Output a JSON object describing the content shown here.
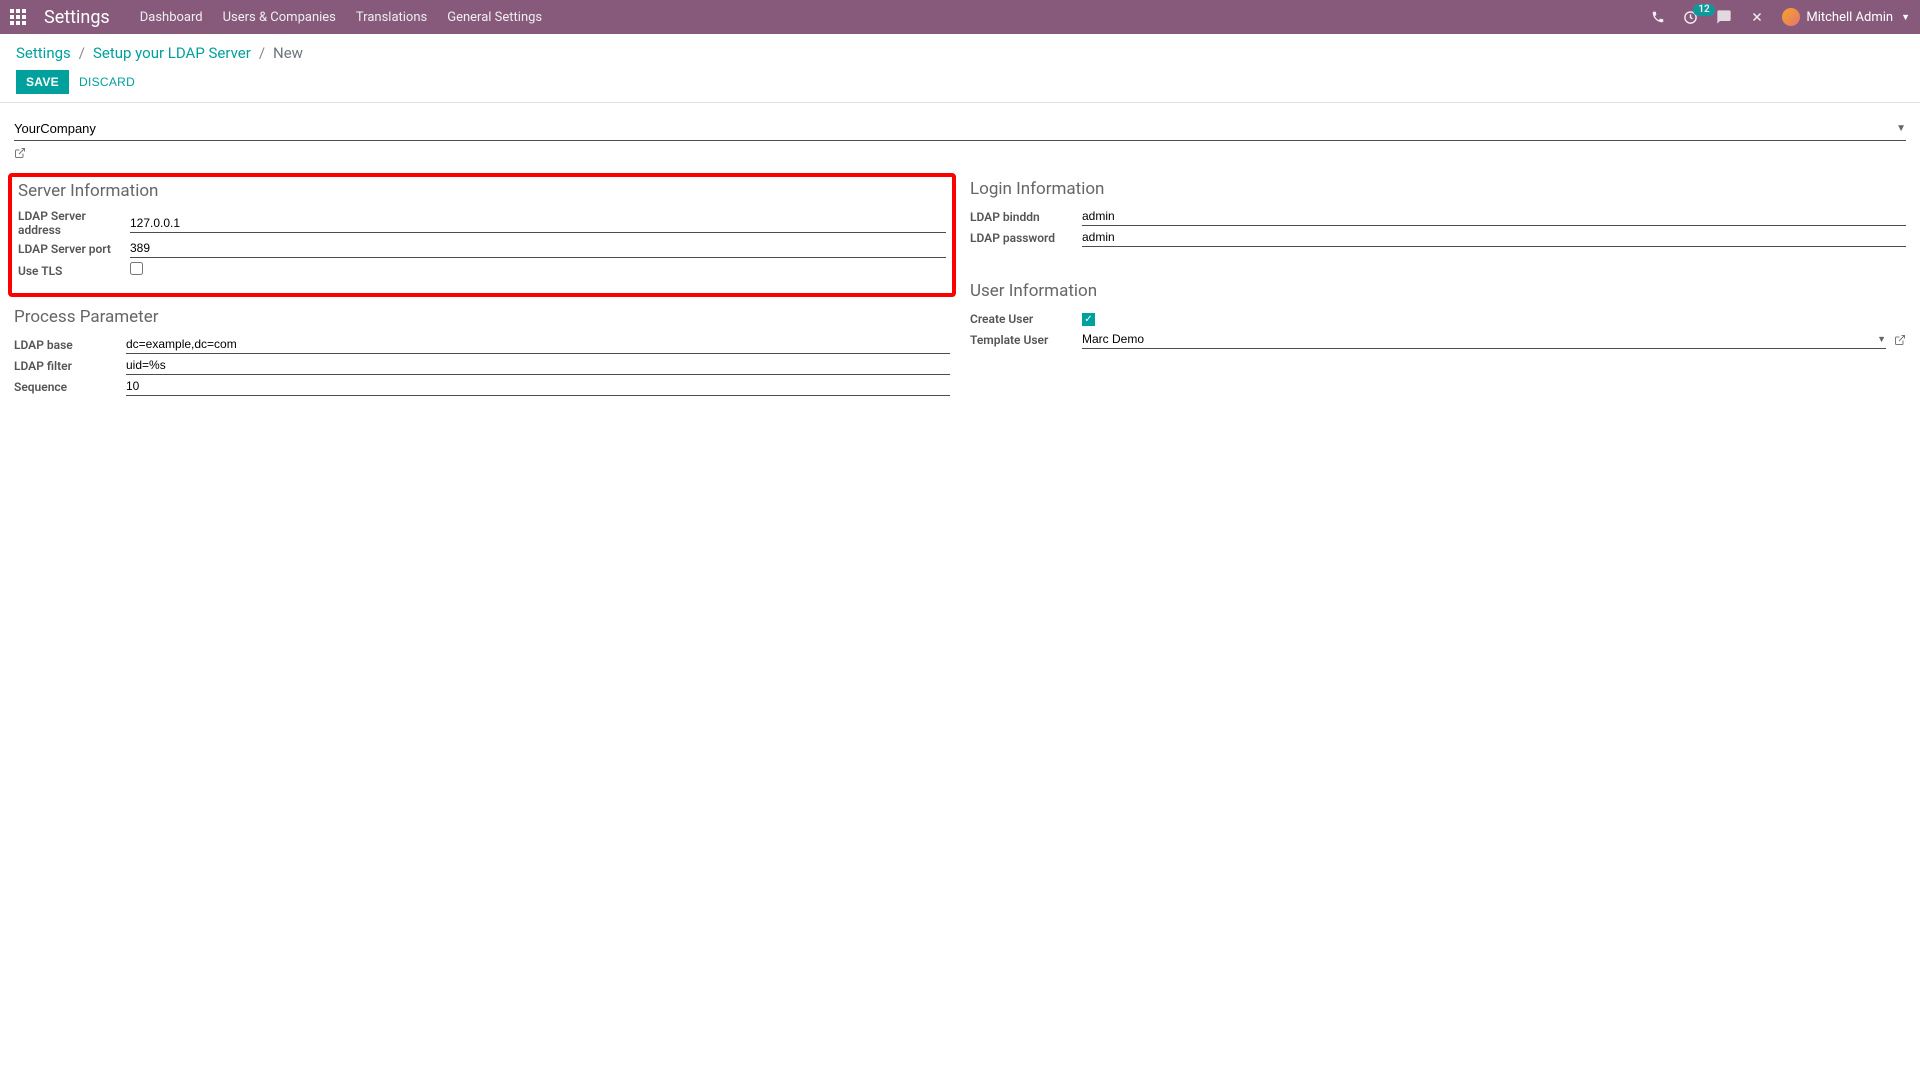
{
  "navbar": {
    "title": "Settings",
    "menu": [
      "Dashboard",
      "Users & Companies",
      "Translations",
      "General Settings"
    ],
    "activity_count": "12",
    "user_name": "Mitchell Admin"
  },
  "breadcrumb": {
    "settings": "Settings",
    "setup_ldap": "Setup your LDAP Server",
    "current": "New"
  },
  "actions": {
    "save": "SAVE",
    "discard": "DISCARD"
  },
  "company": {
    "value": "YourCompany"
  },
  "sections": {
    "server_info": {
      "title": "Server Information",
      "ldap_server_address_label": "LDAP Server address",
      "ldap_server_address_value": "127.0.0.1",
      "ldap_server_port_label": "LDAP Server port",
      "ldap_server_port_value": "389",
      "use_tls_label": "Use TLS"
    },
    "process_param": {
      "title": "Process Parameter",
      "ldap_base_label": "LDAP base",
      "ldap_base_value": "dc=example,dc=com",
      "ldap_filter_label": "LDAP filter",
      "ldap_filter_value": "uid=%s",
      "sequence_label": "Sequence",
      "sequence_value": "10"
    },
    "login_info": {
      "title": "Login Information",
      "binddn_label": "LDAP binddn",
      "binddn_value": "admin",
      "password_label": "LDAP password",
      "password_value": "admin"
    },
    "user_info": {
      "title": "User Information",
      "create_user_label": "Create User",
      "template_user_label": "Template User",
      "template_user_value": "Marc Demo"
    }
  }
}
